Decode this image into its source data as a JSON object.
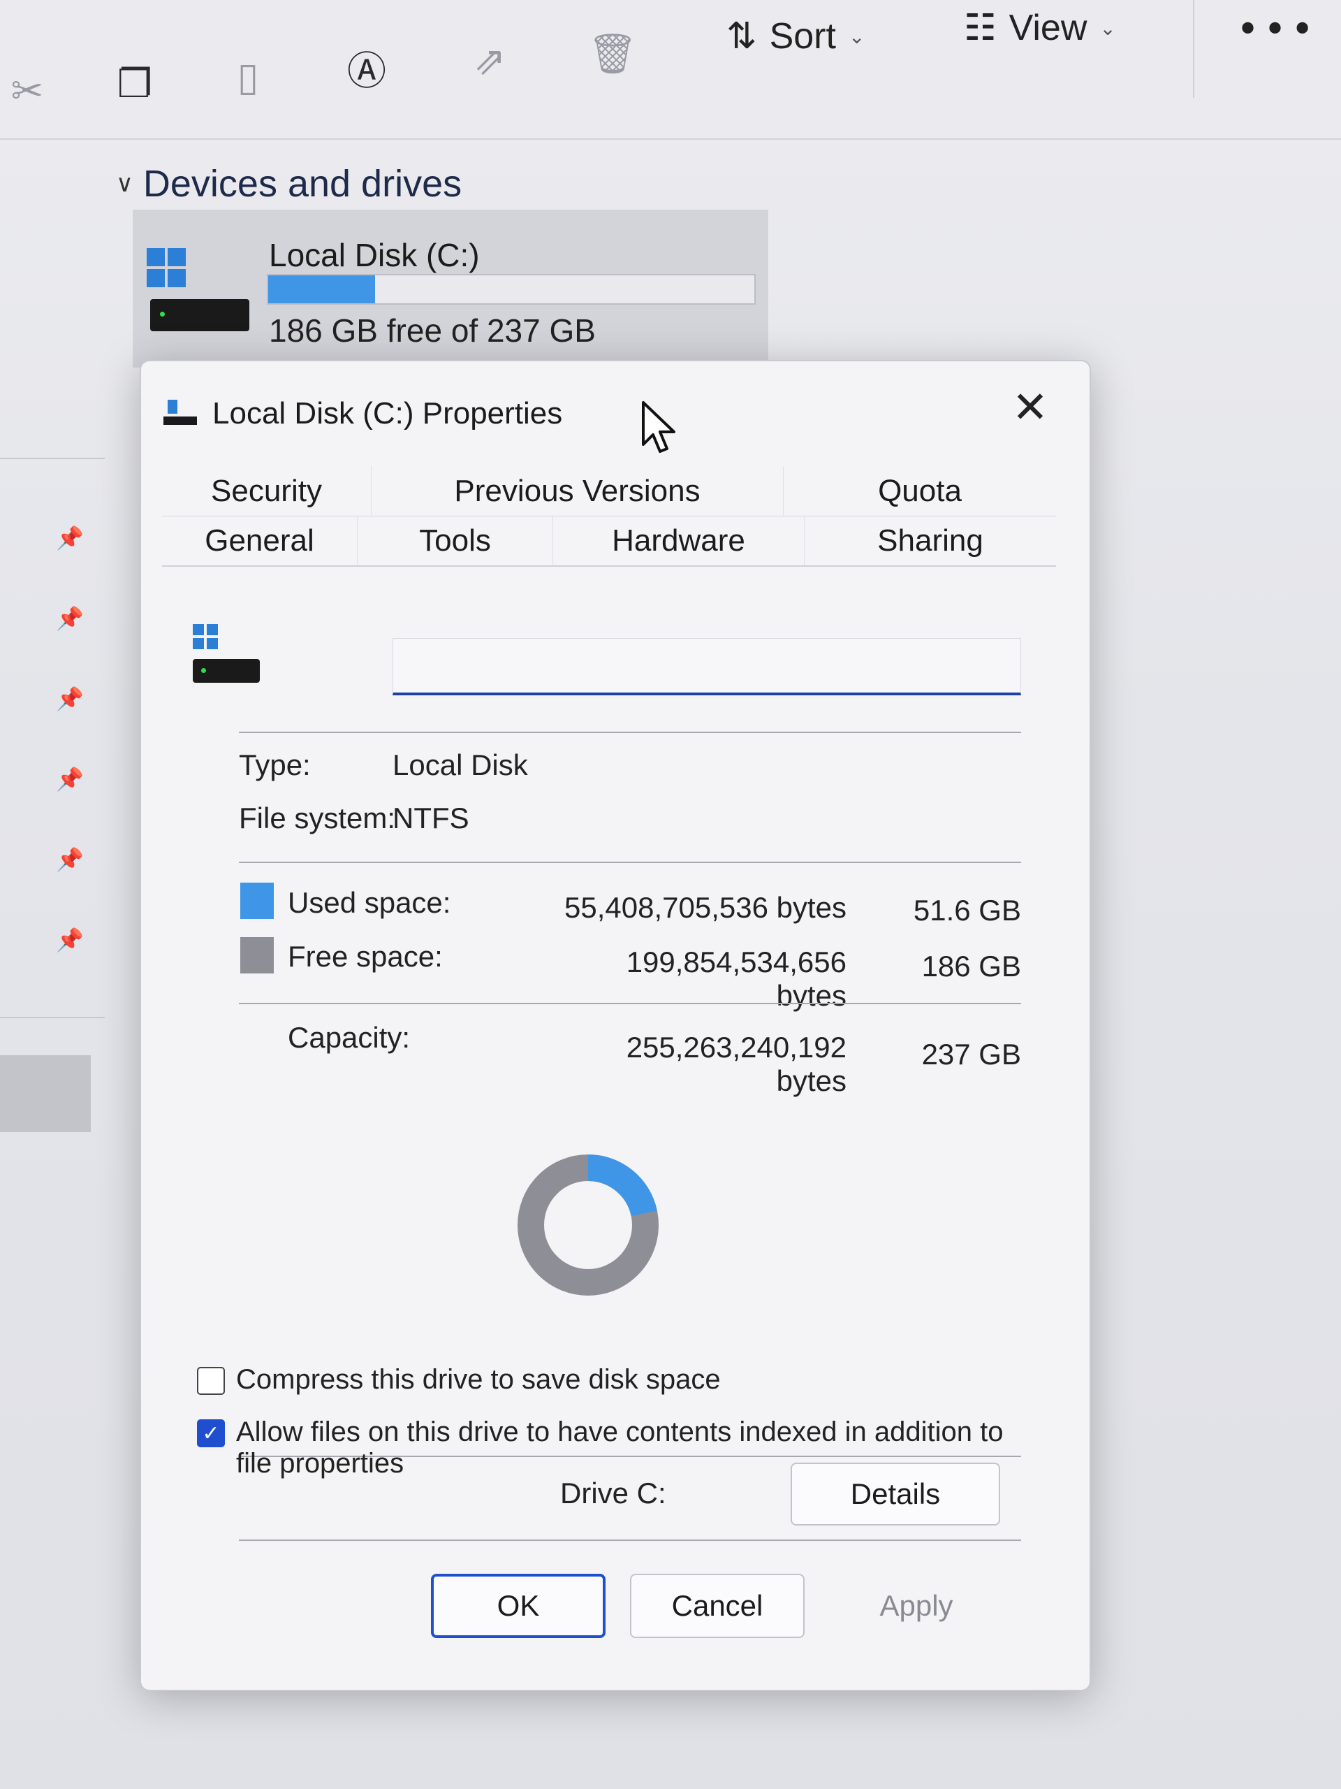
{
  "toolbar": {
    "icons": [
      "cut-icon",
      "copy-icon",
      "paste-icon",
      "rename-icon",
      "share-icon",
      "delete-icon"
    ],
    "sort_label": "Sort",
    "view_label": "View",
    "more_label": "•••"
  },
  "explorer": {
    "section_title": "Devices and drives",
    "drive": {
      "name": "Local Disk (C:)",
      "free_text": "186 GB free of 237 GB",
      "used_fraction": 0.22
    }
  },
  "dialog": {
    "title": "Local Disk (C:) Properties",
    "close_label": "✕",
    "tabs_row1": [
      "Security",
      "Previous Versions",
      "Quota"
    ],
    "tabs_row2": [
      "General",
      "Tools",
      "Hardware",
      "Sharing"
    ],
    "active_tab": "General",
    "label_value": "",
    "type_label": "Type:",
    "type_value": "Local Disk",
    "fs_label": "File system:",
    "fs_value": "NTFS",
    "used_label": "Used space:",
    "used_bytes": "55,408,705,536 bytes",
    "used_size": "51.6 GB",
    "free_label": "Free space:",
    "free_bytes": "199,854,534,656 bytes",
    "free_size": "186 GB",
    "capacity_label": "Capacity:",
    "capacity_bytes": "255,263,240,192 bytes",
    "capacity_size": "237 GB",
    "drive_label": "Drive C:",
    "details_label": "Details",
    "compress_label": "Compress this drive to save disk space",
    "compress_checked": false,
    "index_label": "Allow files on this drive to have contents indexed in addition to file properties",
    "index_checked": true,
    "ok_label": "OK",
    "cancel_label": "Cancel",
    "apply_label": "Apply",
    "used_color": "#3f95e6",
    "free_color": "#8e8e96",
    "used_fraction": 0.217
  }
}
